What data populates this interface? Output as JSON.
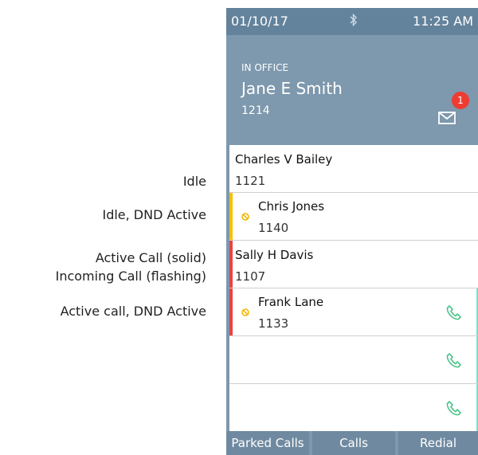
{
  "legend": {
    "idle": "Idle",
    "idle_dnd": "Idle, DND Active",
    "active_call": "Active Call (solid)",
    "incoming_call": "Incoming Call (flashing)",
    "active_call_dnd": "Active call, DND Active"
  },
  "status_bar": {
    "date": "01/10/17",
    "time": "11:25 AM",
    "icon": "bluetooth-icon"
  },
  "user": {
    "presence": "IN OFFICE",
    "name": "Jane E Smith",
    "extension": "1214",
    "voicemail_count": "1",
    "voicemail_icon": "envelope-icon"
  },
  "contacts": [
    {
      "name": "Charles V Bailey",
      "ext": "1121"
    },
    {
      "name": "Chris Jones",
      "ext": "1140"
    },
    {
      "name": "Sally H Davis",
      "ext": "1107"
    },
    {
      "name": "Frank Lane",
      "ext": "1133"
    }
  ],
  "softkeys": {
    "parked": "Parked Calls",
    "calls": "Calls",
    "redial": "Redial"
  },
  "colors": {
    "header": "#7e98ad",
    "statusbar": "#63829b",
    "dnd_yellow": "#f2c200",
    "active_red": "#e64444",
    "call_green": "#4cc48a",
    "badge_red": "#ee3c32"
  }
}
